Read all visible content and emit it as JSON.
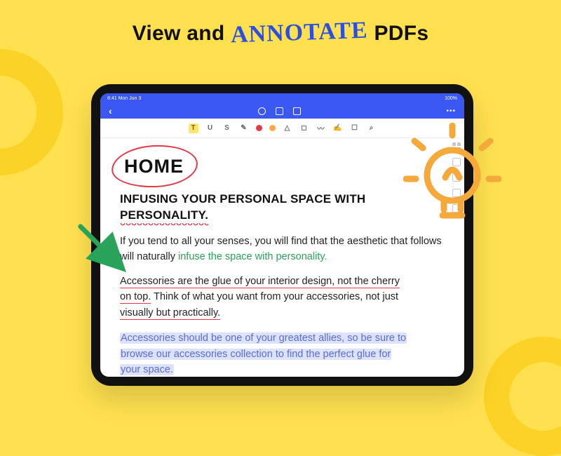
{
  "hero": {
    "part1": "View and ",
    "annotate": "ANNOTATE",
    "part2": " PDFs"
  },
  "statusbar": {
    "time": "8:41  Mon Jun 3",
    "right": "100%"
  },
  "navbar": {
    "back": "‹",
    "more": "•••"
  },
  "toolbar": {
    "icons": [
      "T",
      "U",
      "S",
      "pen",
      "dot-red",
      "dot-or",
      "tri",
      "sq",
      "scribble",
      "person",
      "stamp",
      "search"
    ]
  },
  "document": {
    "title": "HOME",
    "subhead_a": "INFUSING YOUR PERSONAL SPACE WITH",
    "subhead_b": "PERSONALITY.",
    "p1a": "If you tend to all your senses, you will find that the aesthetic that follows will naturally ",
    "p1b": "infuse the space with personality.",
    "p2a": "Accessories are the glue of your interior design, not the cherry",
    "p2b": "on top.",
    "p2c": " Think of what you want from your accessories, not just",
    "p2d": "visually but practically.",
    "p3a": "Accessories should be one of your greatest allies, so be sure to",
    "p3b": "browse our accessories collection to find the perfect glue for",
    "p3c": "your space."
  }
}
